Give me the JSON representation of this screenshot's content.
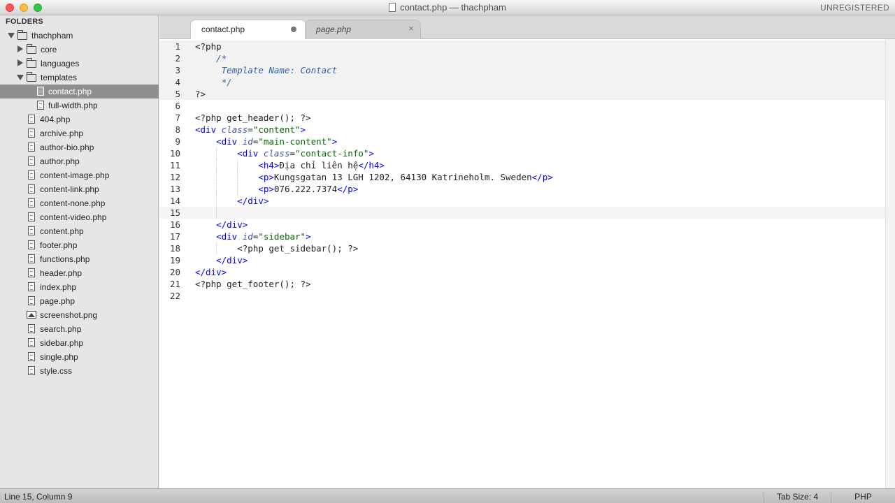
{
  "window": {
    "title": "contact.php — thachpham",
    "registration": "UNREGISTERED"
  },
  "sidebar": {
    "header": "FOLDERS",
    "items": [
      {
        "label": "thachpham",
        "kind": "folder",
        "expanded": true,
        "depth": 0,
        "selected": false
      },
      {
        "label": "core",
        "kind": "folder",
        "expanded": false,
        "depth": 1,
        "selected": false
      },
      {
        "label": "languages",
        "kind": "folder",
        "expanded": false,
        "depth": 1,
        "selected": false
      },
      {
        "label": "templates",
        "kind": "folder",
        "expanded": true,
        "depth": 1,
        "selected": false
      },
      {
        "label": "contact.php",
        "kind": "file",
        "depth": 2,
        "selected": true
      },
      {
        "label": "full-width.php",
        "kind": "file",
        "depth": 2,
        "selected": false
      },
      {
        "label": "404.php",
        "kind": "file",
        "depth": 1,
        "selected": false
      },
      {
        "label": "archive.php",
        "kind": "file",
        "depth": 1,
        "selected": false
      },
      {
        "label": "author-bio.php",
        "kind": "file",
        "depth": 1,
        "selected": false
      },
      {
        "label": "author.php",
        "kind": "file",
        "depth": 1,
        "selected": false
      },
      {
        "label": "content-image.php",
        "kind": "file",
        "depth": 1,
        "selected": false
      },
      {
        "label": "content-link.php",
        "kind": "file",
        "depth": 1,
        "selected": false
      },
      {
        "label": "content-none.php",
        "kind": "file",
        "depth": 1,
        "selected": false
      },
      {
        "label": "content-video.php",
        "kind": "file",
        "depth": 1,
        "selected": false
      },
      {
        "label": "content.php",
        "kind": "file",
        "depth": 1,
        "selected": false
      },
      {
        "label": "footer.php",
        "kind": "file",
        "depth": 1,
        "selected": false
      },
      {
        "label": "functions.php",
        "kind": "file",
        "depth": 1,
        "selected": false
      },
      {
        "label": "header.php",
        "kind": "file",
        "depth": 1,
        "selected": false
      },
      {
        "label": "index.php",
        "kind": "file",
        "depth": 1,
        "selected": false
      },
      {
        "label": "page.php",
        "kind": "file",
        "depth": 1,
        "selected": false
      },
      {
        "label": "screenshot.png",
        "kind": "image",
        "depth": 1,
        "selected": false
      },
      {
        "label": "search.php",
        "kind": "file",
        "depth": 1,
        "selected": false
      },
      {
        "label": "sidebar.php",
        "kind": "file",
        "depth": 1,
        "selected": false
      },
      {
        "label": "single.php",
        "kind": "file",
        "depth": 1,
        "selected": false
      },
      {
        "label": "style.css",
        "kind": "file",
        "depth": 1,
        "selected": false
      }
    ]
  },
  "tabs": [
    {
      "label": "contact.php",
      "active": true,
      "modified": true
    },
    {
      "label": "page.php",
      "active": false,
      "modified": false
    }
  ],
  "editor": {
    "current_line": 15,
    "lines": [
      {
        "n": "1",
        "guides": 0,
        "shade": true,
        "tokens": [
          [
            "t-php",
            "<?php"
          ]
        ]
      },
      {
        "n": "2",
        "guides": 0,
        "shade": true,
        "tokens": [
          [
            "t-text",
            "    "
          ],
          [
            "t-comment",
            "/*"
          ]
        ]
      },
      {
        "n": "3",
        "guides": 0,
        "shade": true,
        "tokens": [
          [
            "t-text",
            "     "
          ],
          [
            "t-comment",
            "Template Name: Contact"
          ]
        ]
      },
      {
        "n": "4",
        "guides": 0,
        "shade": true,
        "tokens": [
          [
            "t-text",
            "     "
          ],
          [
            "t-comment",
            "*/"
          ]
        ]
      },
      {
        "n": "5",
        "guides": 0,
        "shade": true,
        "tokens": [
          [
            "t-php",
            "?>"
          ]
        ]
      },
      {
        "n": "6",
        "guides": 0,
        "tokens": []
      },
      {
        "n": "7",
        "guides": 0,
        "tokens": [
          [
            "t-php",
            "<?php get_header(); ?>"
          ]
        ]
      },
      {
        "n": "8",
        "guides": 0,
        "tokens": [
          [
            "t-tag",
            "<div "
          ],
          [
            "t-attr",
            "class"
          ],
          [
            "t-text",
            "="
          ],
          [
            "t-str",
            "\"content\""
          ],
          [
            "t-tag",
            ">"
          ]
        ]
      },
      {
        "n": "9",
        "guides": 0,
        "tokens": [
          [
            "t-text",
            "    "
          ],
          [
            "t-tag",
            "<div "
          ],
          [
            "t-attr",
            "id"
          ],
          [
            "t-text",
            "="
          ],
          [
            "t-str",
            "\"main-content\""
          ],
          [
            "t-tag",
            ">"
          ]
        ]
      },
      {
        "n": "10",
        "guides": 1,
        "tokens": [
          [
            "t-text",
            "        "
          ],
          [
            "t-tag",
            "<div "
          ],
          [
            "t-attr",
            "class"
          ],
          [
            "t-text",
            "="
          ],
          [
            "t-str",
            "\"contact-info\""
          ],
          [
            "t-tag",
            ">"
          ]
        ]
      },
      {
        "n": "11",
        "guides": 2,
        "tokens": [
          [
            "t-text",
            "            "
          ],
          [
            "t-tag",
            "<h4>"
          ],
          [
            "t-text",
            "Địa chỉ liên hệ"
          ],
          [
            "t-tag",
            "</h4>"
          ]
        ]
      },
      {
        "n": "12",
        "guides": 2,
        "tokens": [
          [
            "t-text",
            "            "
          ],
          [
            "t-tag",
            "<p>"
          ],
          [
            "t-text",
            "Kungsgatan 13 LGH 1202, 64130 Katrineholm. Sweden"
          ],
          [
            "t-tag",
            "</p>"
          ]
        ]
      },
      {
        "n": "13",
        "guides": 2,
        "tokens": [
          [
            "t-text",
            "            "
          ],
          [
            "t-tag",
            "<p>"
          ],
          [
            "t-text",
            "076.222.7374"
          ],
          [
            "t-tag",
            "</p>"
          ]
        ]
      },
      {
        "n": "14",
        "guides": 1,
        "tokens": [
          [
            "t-text",
            "        "
          ],
          [
            "t-tag",
            "</div>"
          ]
        ]
      },
      {
        "n": "15",
        "guides": 1,
        "tokens": []
      },
      {
        "n": "16",
        "guides": 0,
        "tokens": [
          [
            "t-text",
            "    "
          ],
          [
            "t-tag",
            "</div>"
          ]
        ]
      },
      {
        "n": "17",
        "guides": 0,
        "tokens": [
          [
            "t-text",
            "    "
          ],
          [
            "t-tag",
            "<div "
          ],
          [
            "t-attr",
            "id"
          ],
          [
            "t-text",
            "="
          ],
          [
            "t-str",
            "\"sidebar\""
          ],
          [
            "t-tag",
            ">"
          ]
        ]
      },
      {
        "n": "18",
        "guides": 1,
        "tokens": [
          [
            "t-text",
            "        "
          ],
          [
            "t-php",
            "<?php get_sidebar(); ?>"
          ]
        ]
      },
      {
        "n": "19",
        "guides": 0,
        "tokens": [
          [
            "t-text",
            "    "
          ],
          [
            "t-tag",
            "</div>"
          ]
        ]
      },
      {
        "n": "20",
        "guides": 0,
        "tokens": [
          [
            "t-tag",
            "</div>"
          ]
        ]
      },
      {
        "n": "21",
        "guides": 0,
        "tokens": [
          [
            "t-php",
            "<?php get_footer(); ?>"
          ]
        ]
      },
      {
        "n": "22",
        "guides": 0,
        "tokens": []
      }
    ]
  },
  "statusbar": {
    "position": "Line 15, Column 9",
    "tab_size": "Tab Size: 4",
    "syntax": "PHP"
  }
}
